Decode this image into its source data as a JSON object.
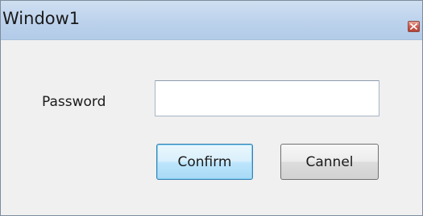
{
  "window": {
    "title": "Window1",
    "close_icon": "close-icon"
  },
  "form": {
    "password_label": "Password",
    "password_value": "",
    "password_placeholder": ""
  },
  "buttons": {
    "confirm_label": "Confirm",
    "cancel_label": "Cannel"
  },
  "colors": {
    "titlebar": "#bcd2ec",
    "close_button": "#c9564a",
    "focused_button_border": "#3c7fb1",
    "window_background": "#f0f0f0"
  }
}
